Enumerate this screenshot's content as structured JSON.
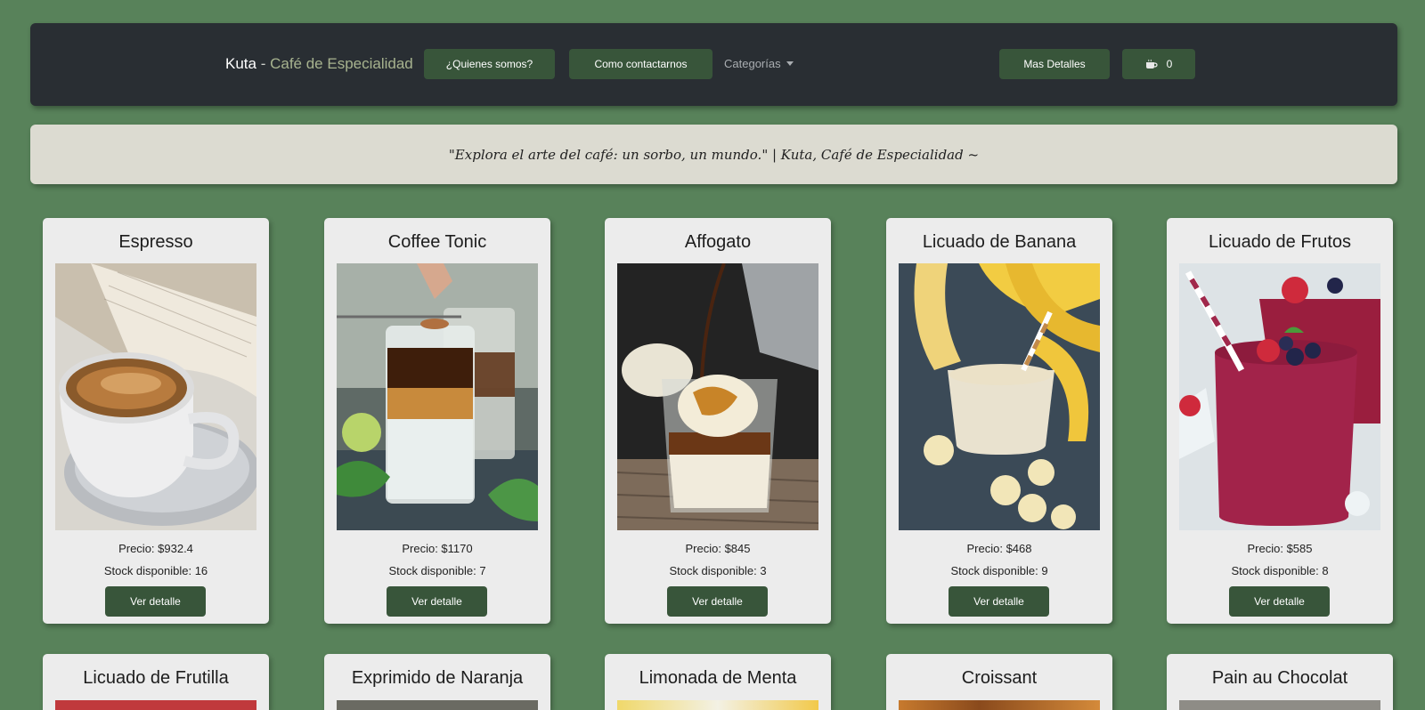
{
  "navbar": {
    "brand_main": "Kuta",
    "brand_dash": " - ",
    "brand_sub": "Café de Especialidad",
    "about_label": "¿Quienes somos?",
    "contact_label": "Como contactarnos",
    "categories_label": "Categorías",
    "details_label": "Mas Detalles",
    "cart_icon": "coffee-cup-icon",
    "cart_count": "0"
  },
  "quote": {
    "text": "\"Explora el arte del café: un sorbo, un mundo.\" | Kuta, Café de Especialidad ~"
  },
  "products": [
    {
      "name": "Espresso",
      "price": "Precio: $932.4",
      "stock": "Stock disponible: 16",
      "button": "Ver detalle"
    },
    {
      "name": "Coffee Tonic",
      "price": "Precio: $1170",
      "stock": "Stock disponible: 7",
      "button": "Ver detalle"
    },
    {
      "name": "Affogato",
      "price": "Precio: $845",
      "stock": "Stock disponible: 3",
      "button": "Ver detalle"
    },
    {
      "name": "Licuado de Banana",
      "price": "Precio: $468",
      "stock": "Stock disponible: 9",
      "button": "Ver detalle"
    },
    {
      "name": "Licuado de Frutos",
      "price": "Precio: $585",
      "stock": "Stock disponible: 8",
      "button": "Ver detalle"
    }
  ],
  "products_row2": [
    {
      "name": "Licuado de Frutilla"
    },
    {
      "name": "Exprimido de Naranja"
    },
    {
      "name": "Limonada de Menta"
    },
    {
      "name": "Croissant"
    },
    {
      "name": "Pain au Chocolat"
    }
  ],
  "colors": {
    "background": "#58825a",
    "navbar": "#292e33",
    "button": "#38553a",
    "quote_bg": "#dcdbd1",
    "card_bg": "#ececec",
    "brand_accent": "#a7b38f"
  }
}
